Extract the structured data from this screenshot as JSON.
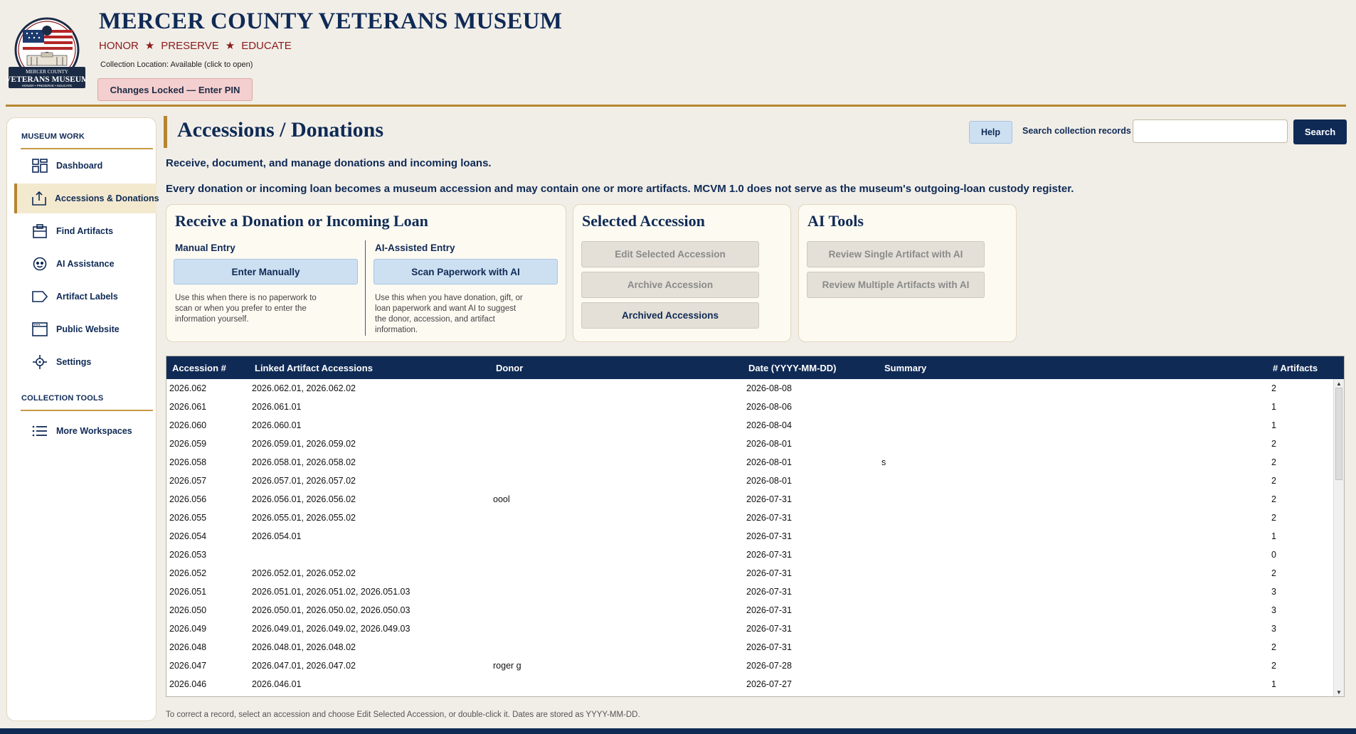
{
  "header": {
    "logo_text_top": "MERCER COUNTY",
    "logo_text_main": "VETERANS MUSEUM",
    "logo_text_bottom": "HONOR • PRESERVE • EDUCATE",
    "title": "MERCER COUNTY VETERANS MUSEUM",
    "tagline": [
      "HONOR",
      "PRESERVE",
      "EDUCATE"
    ],
    "collection_location": "Collection Location: Available (click to open)",
    "lock_button": "Changes Locked — Enter PIN"
  },
  "sidebar": {
    "section1": "MUSEUM WORK",
    "items": [
      {
        "label": "Dashboard",
        "icon": "dashboard-icon"
      },
      {
        "label": "Accessions & Donations",
        "icon": "inbox-icon",
        "active": true
      },
      {
        "label": "Find Artifacts",
        "icon": "clipboard-icon"
      },
      {
        "label": "AI Assistance",
        "icon": "robot-icon"
      },
      {
        "label": "Artifact Labels",
        "icon": "tag-icon"
      },
      {
        "label": "Public Website",
        "icon": "browser-icon"
      },
      {
        "label": "Settings",
        "icon": "settings-icon"
      }
    ],
    "section2": "COLLECTION TOOLS",
    "items2": [
      {
        "label": "More Workspaces",
        "icon": "list-icon"
      }
    ]
  },
  "main": {
    "title": "Accessions / Donations",
    "help_button": "Help",
    "search_label": "Search collection records",
    "search_value": "",
    "search_button": "Search",
    "intro": "Receive, document, and manage donations and incoming loans.",
    "note": "Every donation or incoming loan becomes a museum accession and may contain one or more artifacts. MCVM 1.0 does not serve as the museum's outgoing-loan custody register."
  },
  "panels": {
    "receive": {
      "title": "Receive a Donation or Incoming Loan",
      "manual_head": "Manual Entry",
      "manual_button": "Enter Manually",
      "manual_help": "Use this when there is no paperwork to scan or when you prefer to enter the information yourself.",
      "ai_head": "AI-Assisted Entry",
      "ai_button": "Scan Paperwork with AI",
      "ai_help": "Use this when you have donation, gift, or loan paperwork and want AI to suggest the donor, accession, and artifact information."
    },
    "selected": {
      "title": "Selected Accession",
      "edit_button": "Edit Selected Accession",
      "archive_button": "Archive Accession",
      "archived_button": "Archived Accessions"
    },
    "ai_tools": {
      "title": "AI Tools",
      "single_button": "Review Single Artifact with AI",
      "multi_button": "Review Multiple Artifacts with AI"
    }
  },
  "table": {
    "columns": [
      "Accession #",
      "Linked Artifact Accessions",
      "Donor",
      "Date (YYYY-MM-DD)",
      "Summary",
      "# Artifacts"
    ],
    "rows": [
      [
        "2026.062",
        "2026.062.01, 2026.062.02",
        "",
        "2026-08-08",
        "",
        "2"
      ],
      [
        "2026.061",
        "2026.061.01",
        "",
        "2026-08-06",
        "",
        "1"
      ],
      [
        "2026.060",
        "2026.060.01",
        "",
        "2026-08-04",
        "",
        "1"
      ],
      [
        "2026.059",
        "2026.059.01, 2026.059.02",
        "",
        "2026-08-01",
        "",
        "2"
      ],
      [
        "2026.058",
        "2026.058.01, 2026.058.02",
        "",
        "2026-08-01",
        "s",
        "2"
      ],
      [
        "2026.057",
        "2026.057.01, 2026.057.02",
        "",
        "2026-08-01",
        "",
        "2"
      ],
      [
        "2026.056",
        "2026.056.01, 2026.056.02",
        "oool",
        "2026-07-31",
        "",
        "2"
      ],
      [
        "2026.055",
        "2026.055.01, 2026.055.02",
        "",
        "2026-07-31",
        "",
        "2"
      ],
      [
        "2026.054",
        "2026.054.01",
        "",
        "2026-07-31",
        "",
        "1"
      ],
      [
        "2026.053",
        "",
        "",
        "2026-07-31",
        "",
        "0"
      ],
      [
        "2026.052",
        "2026.052.01, 2026.052.02",
        "",
        "2026-07-31",
        "",
        "2"
      ],
      [
        "2026.051",
        "2026.051.01, 2026.051.02, 2026.051.03",
        "",
        "2026-07-31",
        "",
        "3"
      ],
      [
        "2026.050",
        "2026.050.01, 2026.050.02, 2026.050.03",
        "",
        "2026-07-31",
        "",
        "3"
      ],
      [
        "2026.049",
        "2026.049.01, 2026.049.02, 2026.049.03",
        "",
        "2026-07-31",
        "",
        "3"
      ],
      [
        "2026.048",
        "2026.048.01, 2026.048.02",
        "",
        "2026-07-31",
        "",
        "2"
      ],
      [
        "2026.047",
        "2026.047.01, 2026.047.02",
        "roger g",
        "2026-07-28",
        "",
        "2"
      ],
      [
        "2026.046",
        "2026.046.01",
        "",
        "2026-07-27",
        "",
        "1"
      ]
    ]
  },
  "footer_note": "To correct a record, select an accession and choose Edit Selected Accession, or double-click it. Dates are stored as YYYY-MM-DD.",
  "colors": {
    "navy": "#0f2a55",
    "gold": "#b5862f",
    "background": "#f1eee8",
    "lock_pink": "#f4cfcf",
    "button_blue": "#cde0f2"
  }
}
